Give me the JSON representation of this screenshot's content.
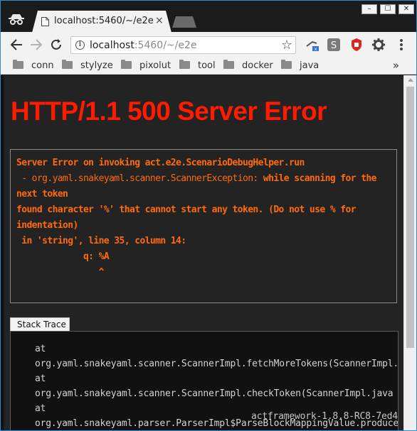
{
  "browser": {
    "tab": {
      "title": "localhost:5460/~/e2e",
      "close_glyph": "×"
    },
    "window_buttons": [
      "–",
      "☐",
      "✕"
    ],
    "address": {
      "host": "localhost",
      "rest": ":5460/~/e2e"
    },
    "icons": {
      "incognito": "incognito-icon",
      "back": "back-arrow-icon",
      "forward": "forward-arrow-icon",
      "info": "info-icon",
      "star": "bookmark-star-icon",
      "ext1": "extension-cast-icon",
      "ext2": "extension-s-icon",
      "ext3": "extension-shield-icon",
      "settings": "gear-icon"
    },
    "bookmarks": [
      "conn",
      "stylyze",
      "pixolut",
      "tool",
      "docker",
      "java"
    ],
    "bookmarks_overflow": "»"
  },
  "page": {
    "heading": "HTTP/1.1 500 Server Error",
    "error": {
      "line1": "Server Error on invoking act.e2e.ScenarioDebugHelper.run",
      "line2a": " - org.yaml.snakeyaml.scanner.ScannerException: ",
      "line2b": "while scanning for the",
      "line3": "next token",
      "line4": "found character '%' that cannot start any token. (Do not use % for",
      "line5": "indentation)",
      "line6": " in 'string', line 35, column 14:",
      "line7": "             q: %A",
      "line8": "                ^"
    },
    "stack_trace_tab": "Stack Trace",
    "stack_trace": [
      "at",
      "org.yaml.snakeyaml.scanner.ScannerImpl.fetchMoreTokens(ScannerImpl.java",
      "at",
      "org.yaml.snakeyaml.scanner.ScannerImpl.checkToken(ScannerImpl.java",
      "at",
      "org.yaml.snakeyaml.parser.ParserImpl$ParseBlockMappingValue.produce("
    ],
    "watermark": "actframework-1.8.8-RC8-7ed4"
  },
  "colors": {
    "heading": "#ff1a00",
    "error_text": "#ff6a0a",
    "page_bg": "#232323"
  }
}
